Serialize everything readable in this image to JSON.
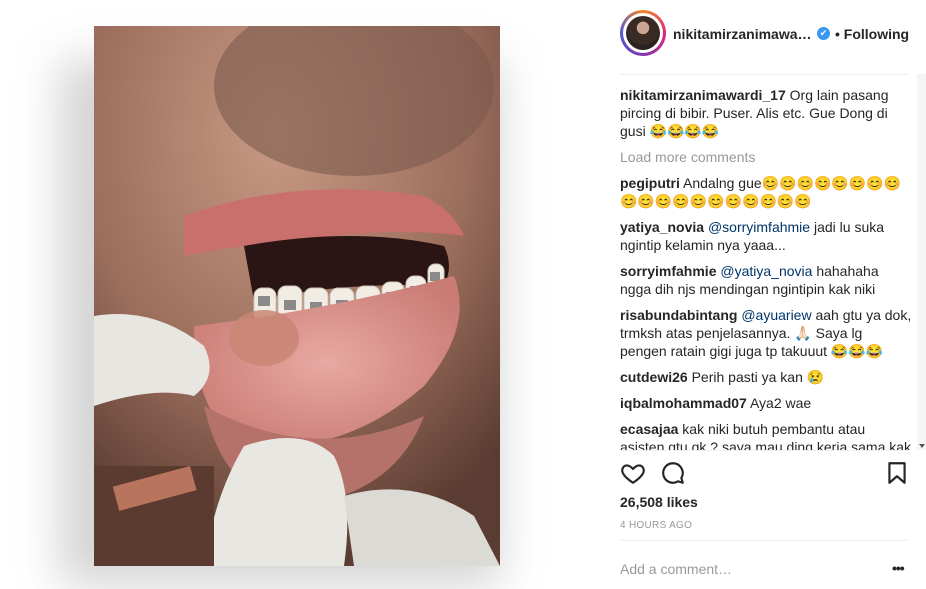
{
  "post": {
    "username": "nikitamirzanimawardi_17",
    "username_display": "nikitamirzanimawa…",
    "following": "• Following",
    "caption_user": "nikitamirzanimawardi_17",
    "caption_text": "Org lain pasang pircing di bibir. Puser. Alis etc. Gue Dong di gusi 😂😂😂😂",
    "load_more": "Load more comments",
    "likes": "26,508 likes",
    "time": "4 HOURS AGO",
    "add_comment_placeholder": "Add a comment…",
    "more_label": "•••"
  },
  "comments": [
    {
      "user": "pegiputri",
      "mention": "",
      "text": "Andalng gue😊😊😊😊😊😊😊😊😊😊😊😊😊😊😊😊😊😊😊"
    },
    {
      "user": "yatiya_novia",
      "mention": "@sorryimfahmie",
      "text": "jadi lu suka ngintip kelamin nya yaaa..."
    },
    {
      "user": "sorryimfahmie",
      "mention": "@yatiya_novia",
      "text": "hahahaha ngga dih njs mendingan ngintipin kak niki"
    },
    {
      "user": "risabundabintang",
      "mention": "@ayuariew",
      "text": "aah gtu ya dok, trmksh atas penjelasannya. 🙏🏻 Saya lg pengen ratain gigi juga tp takuuut 😂😂😂"
    },
    {
      "user": "cutdewi26",
      "mention": "",
      "text": "Perih pasti ya kan 😢"
    },
    {
      "user": "iqbalmohammad07",
      "mention": "",
      "text": "Aya2 wae"
    },
    {
      "user": "ecasajaa",
      "mention": "",
      "text": "kak niki butuh pembantu atau asisten gtu gk ? saya mau ding kerja sama kak niki"
    }
  ],
  "icons": [
    "heart-icon",
    "comment-icon",
    "bookmark-icon",
    "verified-icon"
  ]
}
